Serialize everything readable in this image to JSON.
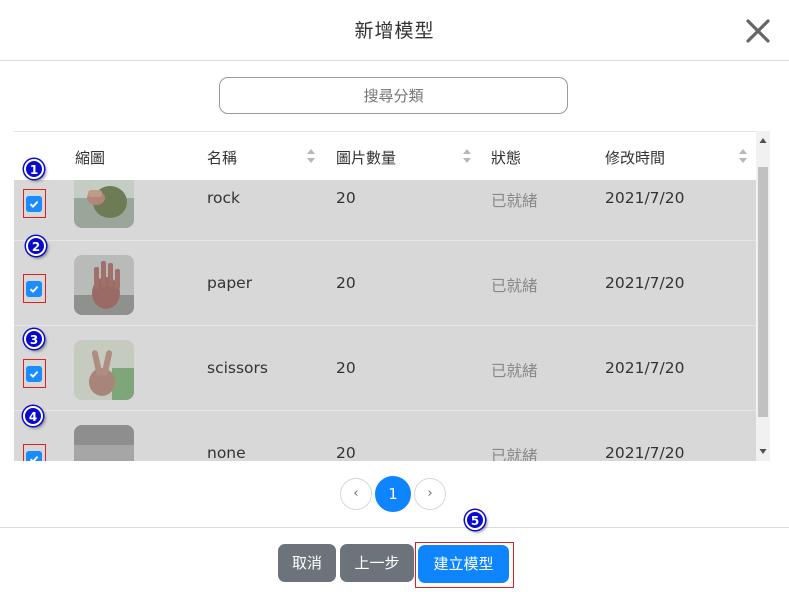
{
  "dialog": {
    "title": "新增模型",
    "close_icon": "close-icon"
  },
  "search": {
    "placeholder": "搜尋分類"
  },
  "table": {
    "columns": {
      "thumbnail": "縮圖",
      "name": "名稱",
      "image_count": "圖片數量",
      "status": "狀態",
      "modified": "修改時間"
    },
    "rows": [
      {
        "badge": "1",
        "checked": true,
        "name": "rock",
        "count": "20",
        "status": "已就緒",
        "modified": "2021/7/20"
      },
      {
        "badge": "2",
        "checked": true,
        "name": "paper",
        "count": "20",
        "status": "已就緒",
        "modified": "2021/7/20"
      },
      {
        "badge": "3",
        "checked": true,
        "name": "scissors",
        "count": "20",
        "status": "已就緒",
        "modified": "2021/7/20"
      },
      {
        "badge": "4",
        "checked": true,
        "name": "none",
        "count": "20",
        "status": "已就緒",
        "modified": "2021/7/20"
      }
    ]
  },
  "pagination": {
    "prev": "‹",
    "current": "1",
    "next": "›"
  },
  "footer": {
    "cancel_label": "取消",
    "back_label": "上一步",
    "create_label": "建立模型",
    "create_badge": "5"
  },
  "colors": {
    "primary": "#0e85ff",
    "secondary": "#6d737a",
    "annotation_badge": "#0a0acc",
    "highlight": "#e02020"
  }
}
